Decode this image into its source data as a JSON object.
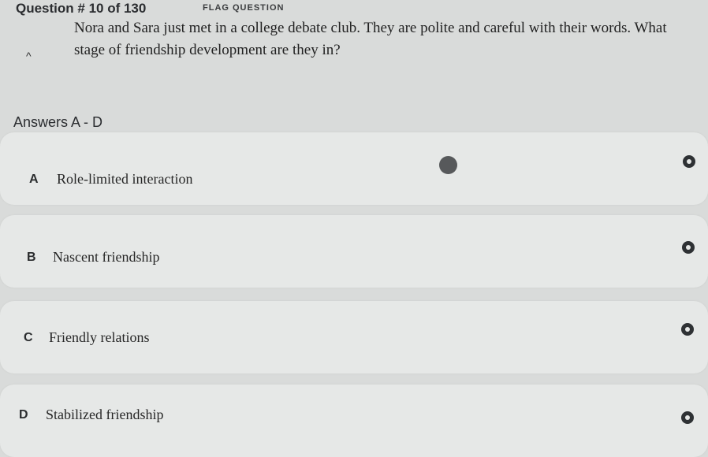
{
  "header": {
    "question_counter": "Question # 10 of 130",
    "flag_label": "FLAG QUESTION"
  },
  "question": {
    "text": "Nora and Sara just met in a college debate club. They are polite and careful with their words. What stage of friendship development are they in?",
    "collapse_icon": "chevron-up-icon"
  },
  "answers": {
    "title": "Answers A - D",
    "options": [
      {
        "letter": "A",
        "text": "Role-limited interaction"
      },
      {
        "letter": "B",
        "text": "Nascent friendship"
      },
      {
        "letter": "C",
        "text": "Friendly relations"
      },
      {
        "letter": "D",
        "text": "Stabilized friendship"
      }
    ]
  },
  "colors": {
    "background": "#d9dbda",
    "card": "#e6e8e7",
    "radio": "#2e3134"
  }
}
